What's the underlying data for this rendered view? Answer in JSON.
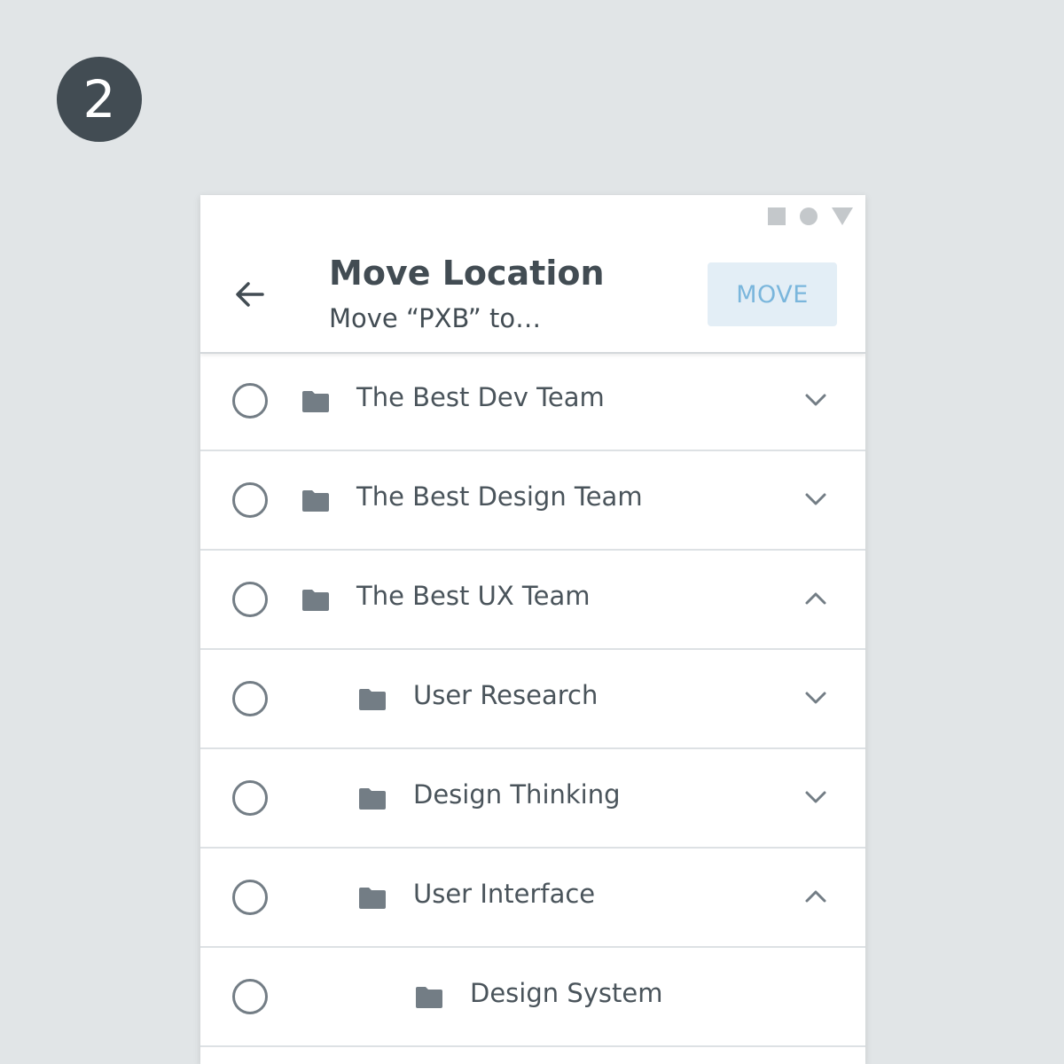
{
  "step": {
    "number": "2"
  },
  "status_bar": {
    "icons": [
      "square-icon",
      "circle-icon",
      "triangle-icon"
    ],
    "color": "#c4c8cb"
  },
  "header": {
    "back_icon": "arrow-left-icon",
    "title": "Move Location",
    "subtitle": "Move “PXB” to…",
    "move_label": "MOVE"
  },
  "colors": {
    "background": "#e1e5e7",
    "badge": "#424c53",
    "text": "#424c53",
    "icon": "#737d85",
    "move_button_bg": "#e3eef6",
    "move_button_text": "#7ab6dc"
  },
  "folders": [
    {
      "label": "The Best Dev Team",
      "indent": 0,
      "chevron": "down"
    },
    {
      "label": "The Best Design Team",
      "indent": 0,
      "chevron": "down"
    },
    {
      "label": "The Best UX Team",
      "indent": 0,
      "chevron": "up"
    },
    {
      "label": "User Research",
      "indent": 1,
      "chevron": "down"
    },
    {
      "label": "Design Thinking",
      "indent": 1,
      "chevron": "down"
    },
    {
      "label": "User Interface",
      "indent": 1,
      "chevron": "up"
    },
    {
      "label": "Design System",
      "indent": 2,
      "chevron": "none"
    }
  ]
}
